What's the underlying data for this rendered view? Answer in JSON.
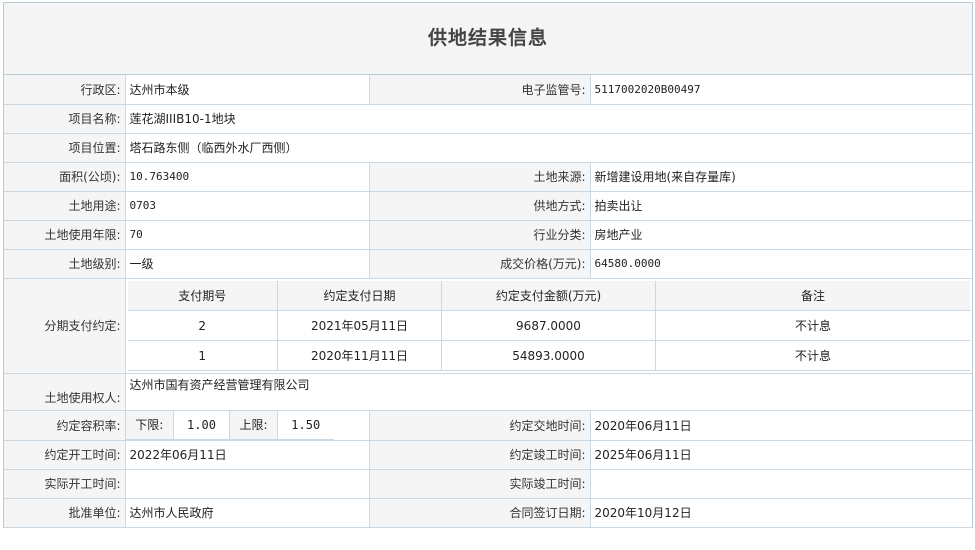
{
  "title": "供地结果信息",
  "fields": {
    "district_label": "行政区:",
    "district_value": "达州市本级",
    "supervision_no_label": "电子监管号:",
    "supervision_no_value": "5117002020B00497",
    "project_name_label": "项目名称:",
    "project_name_value": "莲花湖IIIB10-1地块",
    "project_location_label": "项目位置:",
    "project_location_value": "塔石路东侧（临西外水厂西侧）",
    "area_label": "面积(公顷):",
    "area_value": "10.763400",
    "land_source_label": "土地来源:",
    "land_source_value": "新增建设用地(来自存量库)",
    "land_use_label": "土地用途:",
    "land_use_value": "0703",
    "supply_method_label": "供地方式:",
    "supply_method_value": "拍卖出让",
    "use_years_label": "土地使用年限:",
    "use_years_value": "70",
    "industry_label": "行业分类:",
    "industry_value": "房地产业",
    "land_grade_label": "土地级别:",
    "land_grade_value": "一级",
    "price_label": "成交价格(万元):",
    "price_value": "64580.0000",
    "installment_label": "分期支付约定:",
    "owner_label": "土地使用权人:",
    "owner_value": "达州市国有资产经营管理有限公司",
    "far_label": "约定容积率:",
    "far_lower_label": "下限:",
    "far_lower_value": "1.00",
    "far_upper_label": "上限:",
    "far_upper_value": "1.50",
    "handover_label": "约定交地时间:",
    "handover_value": "2020年06月11日",
    "start_label": "约定开工时间:",
    "start_value": "2022年06月11日",
    "complete_label": "约定竣工时间:",
    "complete_value": "2025年06月11日",
    "actual_start_label": "实际开工时间:",
    "actual_start_value": "",
    "actual_complete_label": "实际竣工时间:",
    "actual_complete_value": "",
    "approver_label": "批准单位:",
    "approver_value": "达州市人民政府",
    "contract_date_label": "合同签订日期:",
    "contract_date_value": "2020年10月12日"
  },
  "installments": {
    "headers": [
      "支付期号",
      "约定支付日期",
      "约定支付金额(万元)",
      "备注"
    ],
    "rows": [
      [
        "2",
        "2021年05月11日",
        "9687.0000",
        "不计息"
      ],
      [
        "1",
        "2020年11月11日",
        "54893.0000",
        "不计息"
      ]
    ]
  }
}
